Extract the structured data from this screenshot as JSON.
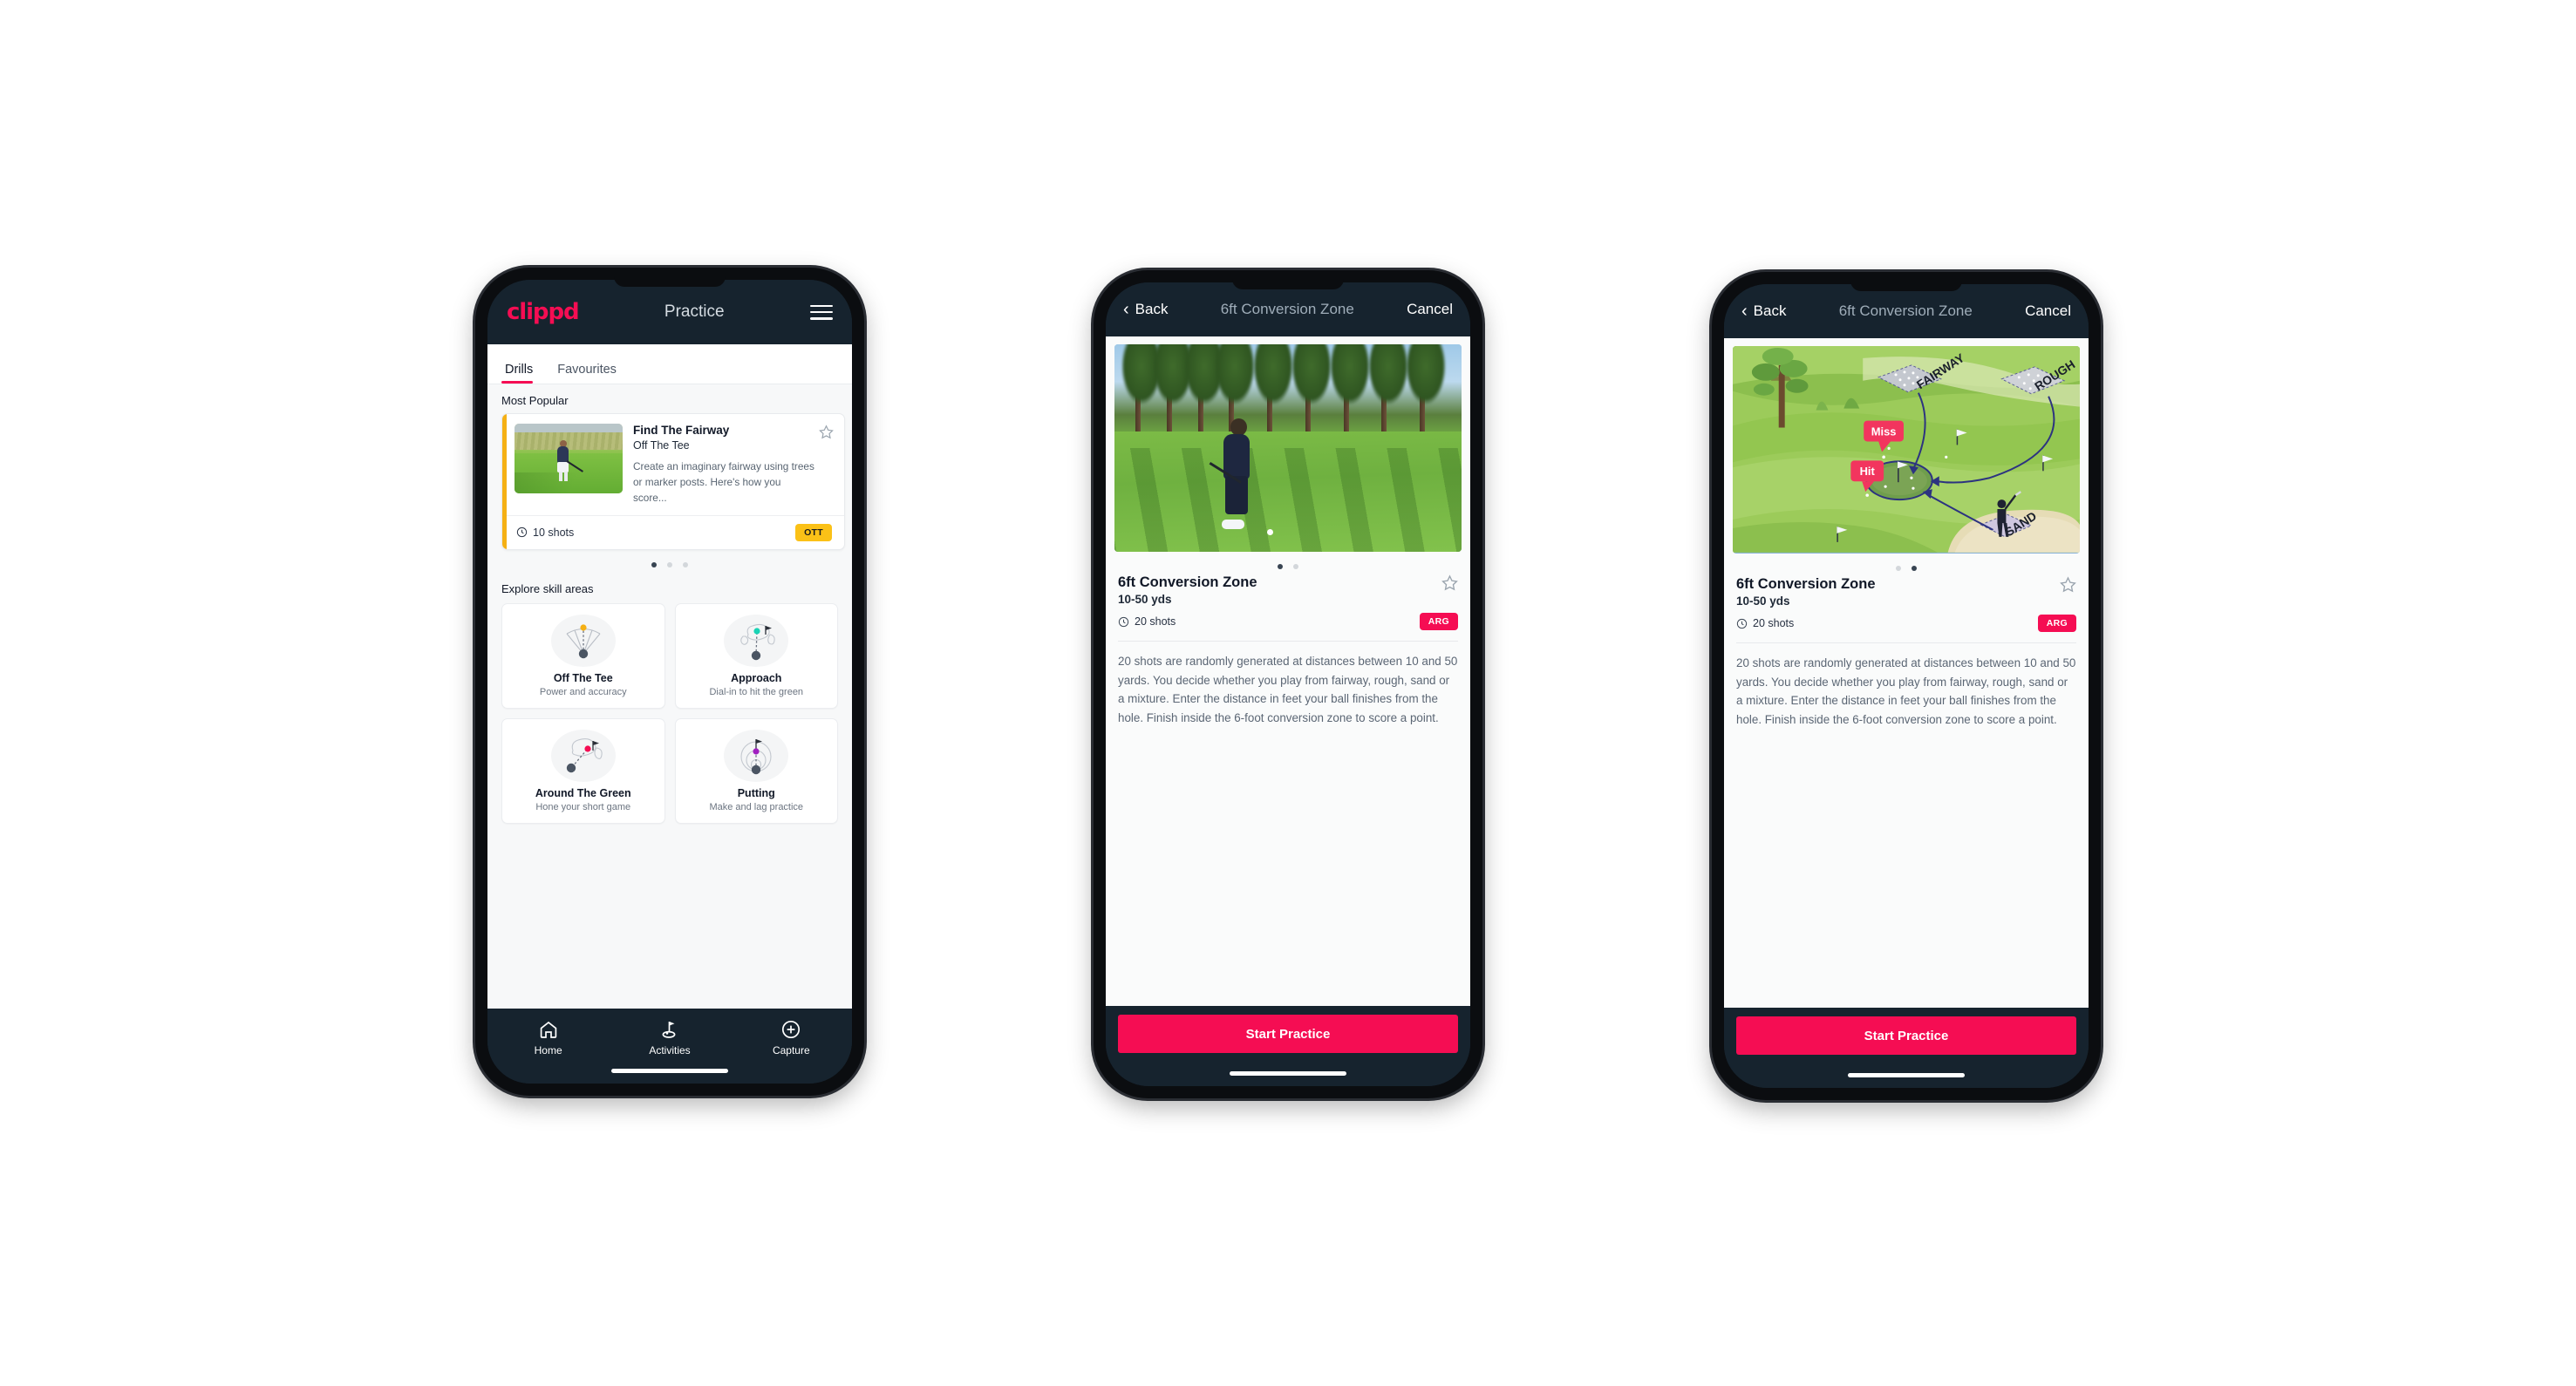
{
  "phones": [
    {
      "id": "phone-practice-list",
      "appbar": {
        "brand": "clippd",
        "title": "Practice",
        "menu_icon": "hamburger-icon"
      },
      "tabs": [
        {
          "label": "Drills",
          "active": true
        },
        {
          "label": "Favourites",
          "active": false
        }
      ],
      "sections": {
        "most_popular_label": "Most Popular",
        "explore_label": "Explore skill areas"
      },
      "drill_card": {
        "title": "Find The Fairway",
        "subtitle": "Off The Tee",
        "description": "Create an imaginary fairway using trees or marker posts. Here's how you score...",
        "shots": "10 shots",
        "chip": "OTT",
        "chip_color": "#fbc117",
        "accent_color": "#f5b014",
        "peek_accent_color": "#19d3b5",
        "star_icon": "star-outline-icon",
        "clock_icon": "clock-icon"
      },
      "carousel": {
        "count": 3,
        "active_index": 0
      },
      "skills": [
        {
          "title": "Off The Tee",
          "subtitle": "Power and accuracy",
          "icon": "tee-dispersion-icon",
          "accent": "#f5b014"
        },
        {
          "title": "Approach",
          "subtitle": "Dial-in to hit the green",
          "icon": "approach-green-icon",
          "accent": "#19d3b5"
        },
        {
          "title": "Around The Green",
          "subtitle": "Hone your short game",
          "icon": "chip-green-icon",
          "accent": "#f50d53"
        },
        {
          "title": "Putting",
          "subtitle": "Make and lag practice",
          "icon": "putting-rings-icon",
          "accent": "#a020c0"
        }
      ],
      "tabbar": [
        {
          "label": "Home",
          "icon": "home-icon",
          "active": false
        },
        {
          "label": "Activities",
          "icon": "golf-flag-icon",
          "active": true
        },
        {
          "label": "Capture",
          "icon": "plus-circle-icon",
          "active": false
        }
      ]
    },
    {
      "id": "phone-detail-video",
      "navbar": {
        "back": "Back",
        "title": "6ft Conversion Zone",
        "cancel": "Cancel",
        "back_icon": "chevron-left-icon"
      },
      "media": {
        "type": "photo",
        "alt": "golfer chipping on fairway surrounded by pine trees"
      },
      "carousel": {
        "count": 2,
        "active_index": 0
      },
      "detail": {
        "title": "6ft Conversion Zone",
        "yards": "10-50 yds",
        "shots": "20 shots",
        "chip": "ARG",
        "chip_color": "#f50d53",
        "description": "20 shots are randomly generated at distances between 10 and 50 yards. You decide whether you play from fairway, rough, sand or a mixture. Enter the distance in feet your ball finishes from the hole. Finish inside the 6-foot conversion zone to score a point.",
        "star_icon": "star-outline-icon",
        "clock_icon": "clock-icon"
      },
      "cta": {
        "label": "Start Practice",
        "color": "#f50d53"
      }
    },
    {
      "id": "phone-detail-diagram",
      "navbar": {
        "back": "Back",
        "title": "6ft Conversion Zone",
        "cancel": "Cancel",
        "back_icon": "chevron-left-icon"
      },
      "media": {
        "type": "illustration",
        "alt": "isometric golf hole diagram",
        "labels": [
          "FAIRWAY",
          "ROUGH",
          "SAND"
        ],
        "markers": [
          {
            "label": "Miss",
            "color": "#f2355e"
          },
          {
            "label": "Hit",
            "color": "#f2355e"
          }
        ]
      },
      "carousel": {
        "count": 2,
        "active_index": 1
      },
      "detail": {
        "title": "6ft Conversion Zone",
        "yards": "10-50 yds",
        "shots": "20 shots",
        "chip": "ARG",
        "chip_color": "#f50d53",
        "description": "20 shots are randomly generated at distances between 10 and 50 yards. You decide whether you play from fairway, rough, sand or a mixture. Enter the distance in feet your ball finishes from the hole. Finish inside the 6-foot conversion zone to score a point.",
        "star_icon": "star-outline-icon",
        "clock_icon": "clock-icon"
      },
      "cta": {
        "label": "Start Practice",
        "color": "#f50d53"
      }
    }
  ],
  "theme": {
    "brand_pink": "#f50d53",
    "dark_navy": "#16232e",
    "page_bg": "#ffffff",
    "content_bg": "#f7f8f9"
  }
}
